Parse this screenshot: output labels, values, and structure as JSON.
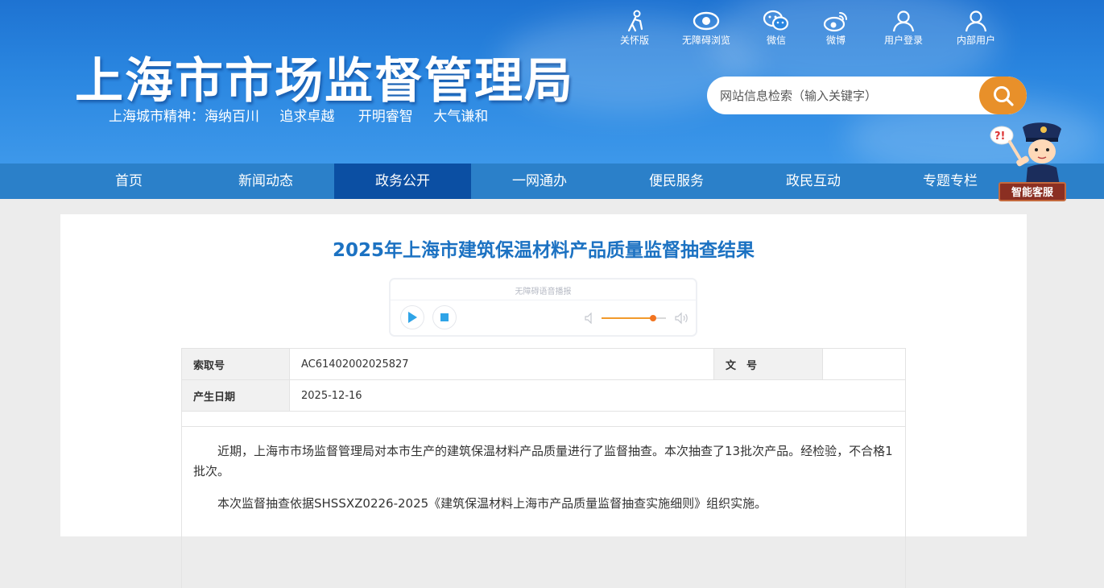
{
  "header": {
    "site_title": "上海市市场监督管理局",
    "slogan": [
      "上海城市精神：海纳百川",
      "追求卓越",
      "开明睿智",
      "大气谦和"
    ],
    "top_links": [
      {
        "label": "关怀版",
        "icon": "elderly-care-icon"
      },
      {
        "label": "无障碍浏览",
        "icon": "eye-icon"
      },
      {
        "label": "微信",
        "icon": "wechat-icon"
      },
      {
        "label": "微博",
        "icon": "weibo-icon"
      },
      {
        "label": "用户登录",
        "icon": "user-icon"
      },
      {
        "label": "内部用户",
        "icon": "user-icon"
      }
    ],
    "search": {
      "placeholder": "网站信息检索（输入关键字）",
      "value": "",
      "icon": "search-icon"
    },
    "colors": {
      "header_blue": "#2a86e0",
      "search_button": "#e8902a"
    }
  },
  "nav": {
    "items": [
      "首页",
      "新闻动态",
      "政务公开",
      "一网通办",
      "便民服务",
      "政民互动",
      "专题专栏"
    ],
    "active": "政务公开",
    "colors": {
      "bar": "#2b80c9",
      "active": "#0b4fa3"
    }
  },
  "assistant": {
    "label": "智能客服",
    "icon": "police-mascot-icon"
  },
  "article": {
    "title": "2025年上海市建筑保温材料产品质量监督抽查结果",
    "player": {
      "caption": "无障碍语音播报",
      "volume": 0.8,
      "icons": [
        "play-icon",
        "stop-icon",
        "volume-low-icon",
        "volume-high-icon"
      ]
    },
    "meta": {
      "index_label": "索取号",
      "index_value": "AC61402002025827",
      "doc_no_label": "文　号",
      "doc_no_value": "",
      "date_label": "产生日期",
      "date_value": "2025-12-16"
    },
    "paragraphs": [
      "近期，上海市市场监督管理局对本市生产的建筑保温材料产品质量进行了监督抽查。本次抽查了13批次产品。经检验，不合格1批次。",
      "本次监督抽查依据SHSSXZ0226-2025《建筑保温材料上海市产品质量监督抽查实施细则》组织实施。"
    ],
    "title_color": "#1c72c2"
  }
}
